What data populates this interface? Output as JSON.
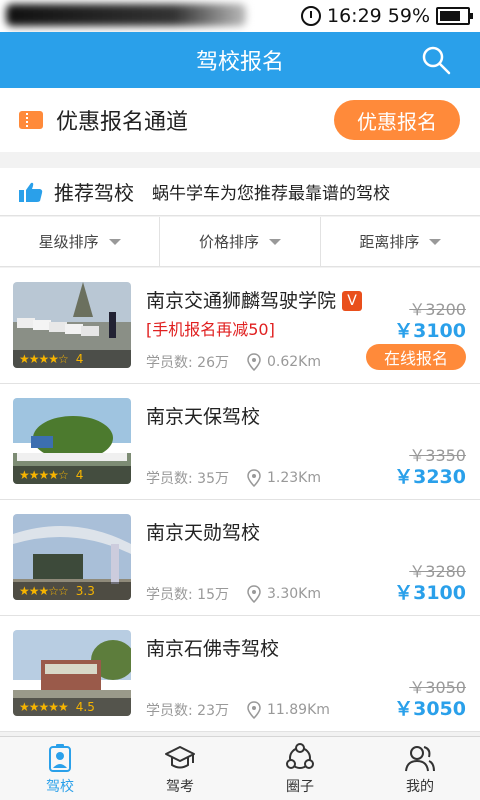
{
  "status_bar": {
    "time": "16:29",
    "battery": "59%"
  },
  "header": {
    "title": "驾校报名"
  },
  "promo": {
    "title": "优惠报名通道",
    "button": "优惠报名"
  },
  "recommend": {
    "title": "推荐驾校",
    "subtitle": "蜗牛学车为您推荐最靠谱的驾校"
  },
  "sort": {
    "star": "星级排序",
    "price": "价格排序",
    "distance": "距离排序"
  },
  "schools": [
    {
      "name": "南京交通狮麟驾驶学院",
      "badge": "V",
      "promo": "[手机报名再减50]",
      "students": "学员数: 26万",
      "distance": "0.62Km",
      "old_price": "￥3200",
      "price": "￥3100",
      "rating": "4",
      "stars": 4,
      "apply": "在线报名"
    },
    {
      "name": "南京天保驾校",
      "students": "学员数: 35万",
      "distance": "1.23Km",
      "old_price": "￥3350",
      "price": "￥3230",
      "rating": "4",
      "stars": 4
    },
    {
      "name": "南京天勋驾校",
      "students": "学员数: 15万",
      "distance": "3.30Km",
      "old_price": "￥3280",
      "price": "￥3100",
      "rating": "3.3",
      "stars": 3.3
    },
    {
      "name": "南京石佛寺驾校",
      "students": "学员数: 23万",
      "distance": "11.89Km",
      "old_price": "￥3050",
      "price": "￥3050",
      "rating": "4.5",
      "stars": 4.5
    }
  ],
  "tabs": {
    "school": "驾校",
    "exam": "驾考",
    "circle": "圈子",
    "mine": "我的"
  },
  "colors": {
    "primary": "#2aa0ea",
    "accent": "#ff8a3a",
    "promo_red": "#e02020",
    "badge": "#e94f1c"
  }
}
